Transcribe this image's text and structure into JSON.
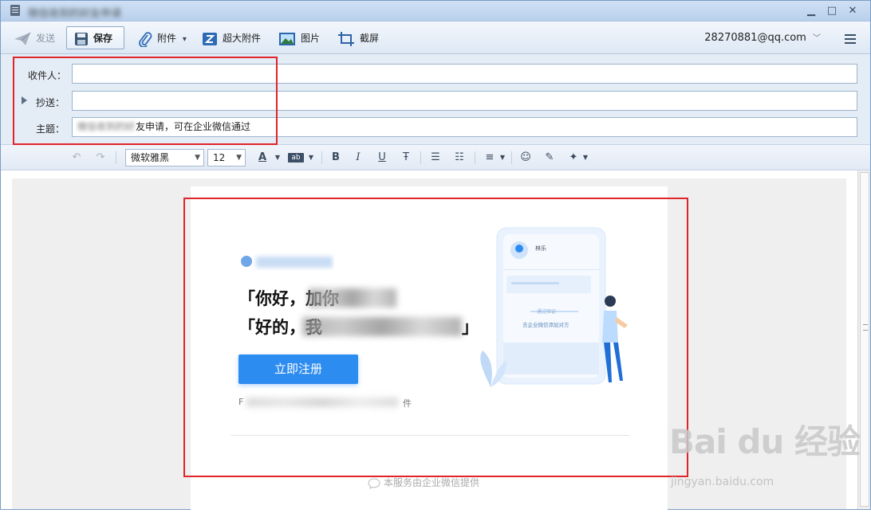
{
  "window": {
    "title": "微信收到的好友申请",
    "min_glyph": "▁",
    "max_glyph": "□",
    "close_glyph": "✕"
  },
  "toolbar": {
    "send_label": "发送",
    "save_label": "保存",
    "attach_label": "附件",
    "big_attach_label": "超大附件",
    "image_label": "图片",
    "screenshot_label": "截屏",
    "account": "28270881@qq.com",
    "account_arrow": "﹀",
    "attach_arrow": "▾"
  },
  "fields": {
    "to_label": "收件人：",
    "cc_label": "抄送：",
    "subject_label": "主题：",
    "to_value": "",
    "cc_value": "",
    "subject_blurred": "微信收到的好",
    "subject_value": "友申请，可在企业微信通过"
  },
  "format": {
    "font_family": "微软雅黑",
    "font_size": "12",
    "undo": "↶",
    "redo": "↷",
    "bold": "B",
    "italic": "I",
    "underline": "U",
    "strike": "Ŧ",
    "font_color": "A",
    "highlight": "ab",
    "bullets": "☰",
    "numbering": "☷",
    "align": "≡",
    "emoji": "☺",
    "clear_format": "✎",
    "magic": "✦"
  },
  "email": {
    "headline1_visible": "「你好，加你",
    "headline2_visible": "「好的，我",
    "headline1_end": "",
    "headline2_end": "」",
    "cta": "立即注册",
    "footnote_start": "F",
    "footnote_end": "件",
    "provider": "本服务由企业微信提供",
    "card_name": "林乐",
    "card_pill": "通过验证",
    "card_caption": "去企业微信添加对方"
  },
  "watermark": {
    "main": "Bai du 经验",
    "sub": "jingyan.baidu.com"
  },
  "colors": {
    "accent": "#2d8cf0",
    "highlight_red": "#e0242a",
    "titlebar": "#cfe0f4"
  }
}
